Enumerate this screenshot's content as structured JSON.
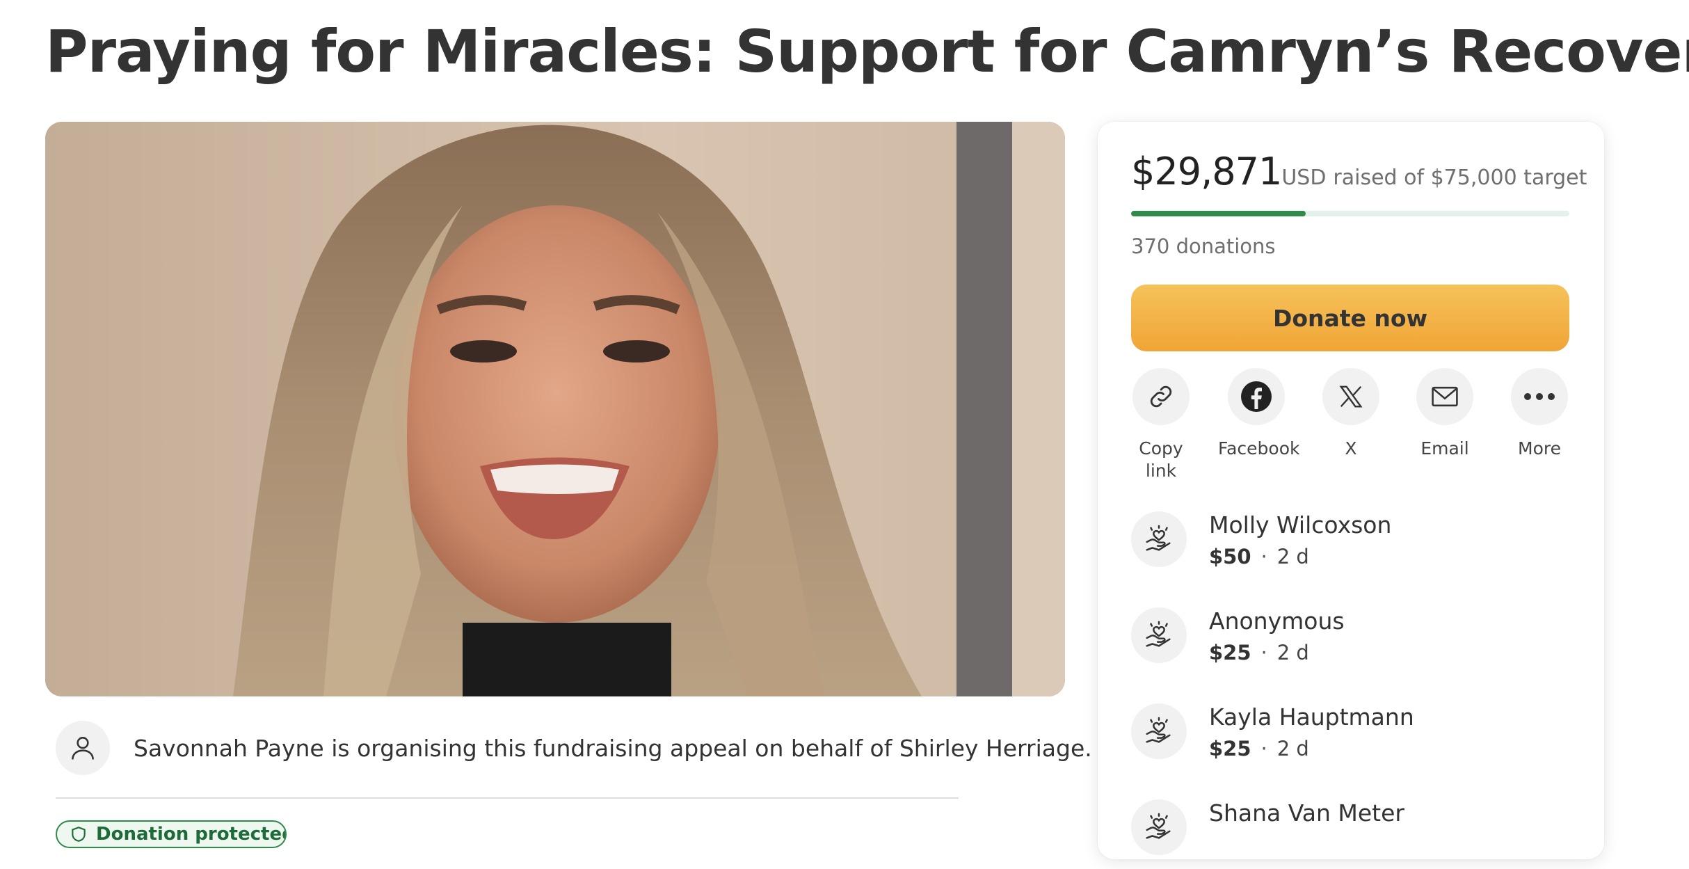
{
  "page": {
    "title": "Praying for Miracles: Support for Camryn’s Recover"
  },
  "hero": {
    "image": "smiling young woman with long blonde highlighted hair"
  },
  "organiser": {
    "icon": "user-icon",
    "text": "Savonnah Payne is organising this fundraising appeal on behalf of Shirley Herriage."
  },
  "badge": {
    "text": "Donation protected",
    "icon": "shield-icon"
  },
  "sidebar": {
    "raised_amount": "$29,871",
    "currency": "USD",
    "raised_text": "raised of $75,000 target",
    "progress": 0.398,
    "progress_color": "#2f8a4b",
    "donations_count": "370 donations",
    "donate_label": "Donate now",
    "donate_color": "#f0a535",
    "share": [
      {
        "label": "Copy link",
        "icon": "link-icon"
      },
      {
        "label": "Facebook",
        "icon": "facebook-icon"
      },
      {
        "label": "X",
        "icon": "x-icon"
      },
      {
        "label": "Email",
        "icon": "email-icon"
      },
      {
        "label": "More",
        "icon": "more-icon"
      }
    ],
    "donors": [
      {
        "name": "Molly Wilcoxson",
        "amount": "$50",
        "time": "2 d"
      },
      {
        "name": "Anonymous",
        "amount": "$25",
        "time": "2 d"
      },
      {
        "name": "Kayla Hauptmann",
        "amount": "$25",
        "time": "2 d"
      },
      {
        "name": "Shana Van Meter",
        "amount": "",
        "time": ""
      }
    ]
  }
}
